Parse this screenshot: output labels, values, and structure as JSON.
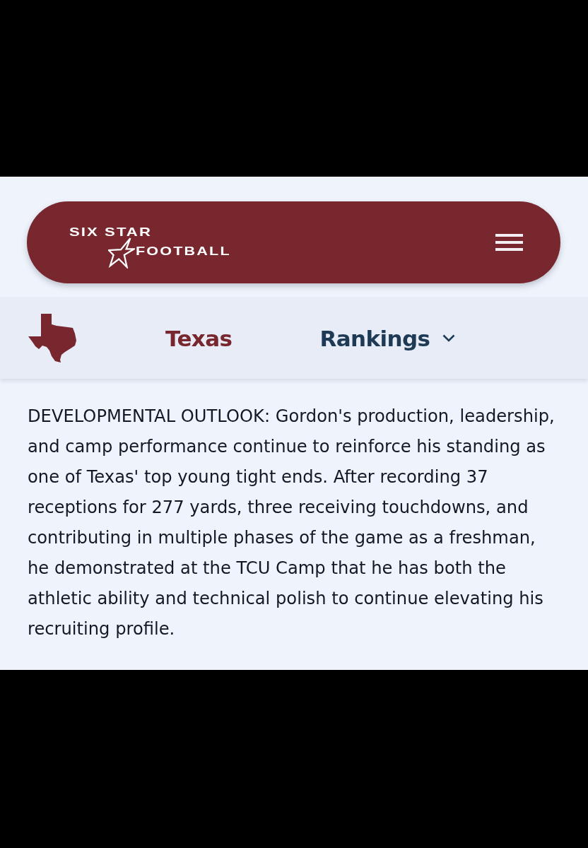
{
  "header": {
    "logo": {
      "line_1": "SIX STAR",
      "line_2": "FOOTBALL"
    }
  },
  "nav": {
    "items": [
      {
        "label": "Texas",
        "selected": true,
        "kind": "link"
      },
      {
        "label": "Rankings",
        "selected": false,
        "kind": "dropdown"
      }
    ]
  },
  "article": {
    "paragraph": "DEVELOPMENTAL OUTLOOK: Gordon's production, leadership, and camp performance continue to reinforce his standing as one of Texas' top young tight ends. After recording 37 receptions for 277 yards, three receiving touchdowns, and contributing in multiple phases of the game as a freshman, he demonstrated at the TCU Camp that he has both the athletic ability and technical polish to continue elevating his recruiting profile."
  }
}
